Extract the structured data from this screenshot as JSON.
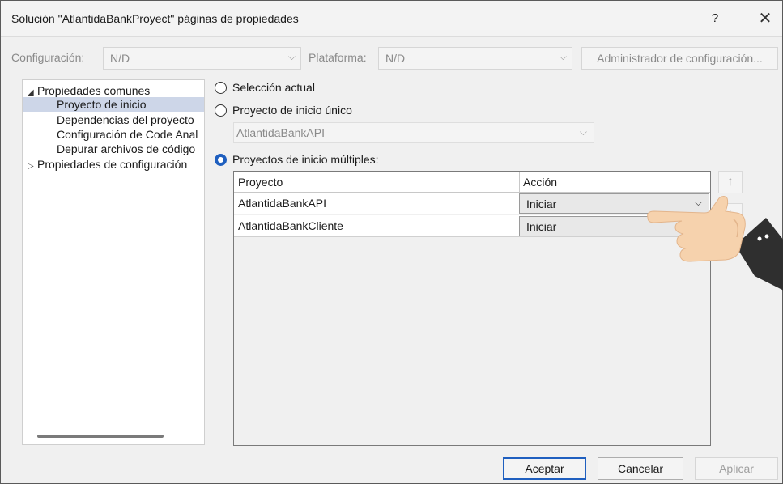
{
  "window": {
    "title": "Solución \"AtlantidaBankProyect\" páginas de propiedades",
    "help_label": "?",
    "close_label": "✕"
  },
  "config_bar": {
    "configuration_label": "Configuración:",
    "configuration_value": "N/D",
    "platform_label": "Plataforma:",
    "platform_value": "N/D",
    "config_manager_button": "Administrador de configuración..."
  },
  "tree": {
    "items": [
      {
        "label": "Propiedades comunes",
        "expander": "◢"
      },
      {
        "label": "Proyecto de inicio"
      },
      {
        "label": "Dependencias del proyecto"
      },
      {
        "label": "Configuración de Code Anal"
      },
      {
        "label": "Depurar archivos de código"
      },
      {
        "label": "Propiedades de configuración",
        "expander": "▷"
      }
    ]
  },
  "startup": {
    "option_current": "Selección actual",
    "option_single": "Proyecto de inicio único",
    "single_value": "AtlantidaBankAPI",
    "option_multiple": "Proyectos de inicio múltiples:",
    "selected_option": "multiple"
  },
  "grid": {
    "col_project": "Proyecto",
    "col_action": "Acción",
    "rows": [
      {
        "project": "AtlantidaBankAPI",
        "action": "Iniciar"
      },
      {
        "project": "AtlantidaBankCliente",
        "action": "Iniciar"
      }
    ]
  },
  "buttons": {
    "ok": "Aceptar",
    "cancel": "Cancelar",
    "apply": "Aplicar"
  },
  "colors": {
    "accent": "#1f5fbf",
    "selection": "#cdd6e8"
  },
  "icons": {
    "chevron": "⌵",
    "up_arrow": "↑",
    "down_arrow": "↓"
  }
}
